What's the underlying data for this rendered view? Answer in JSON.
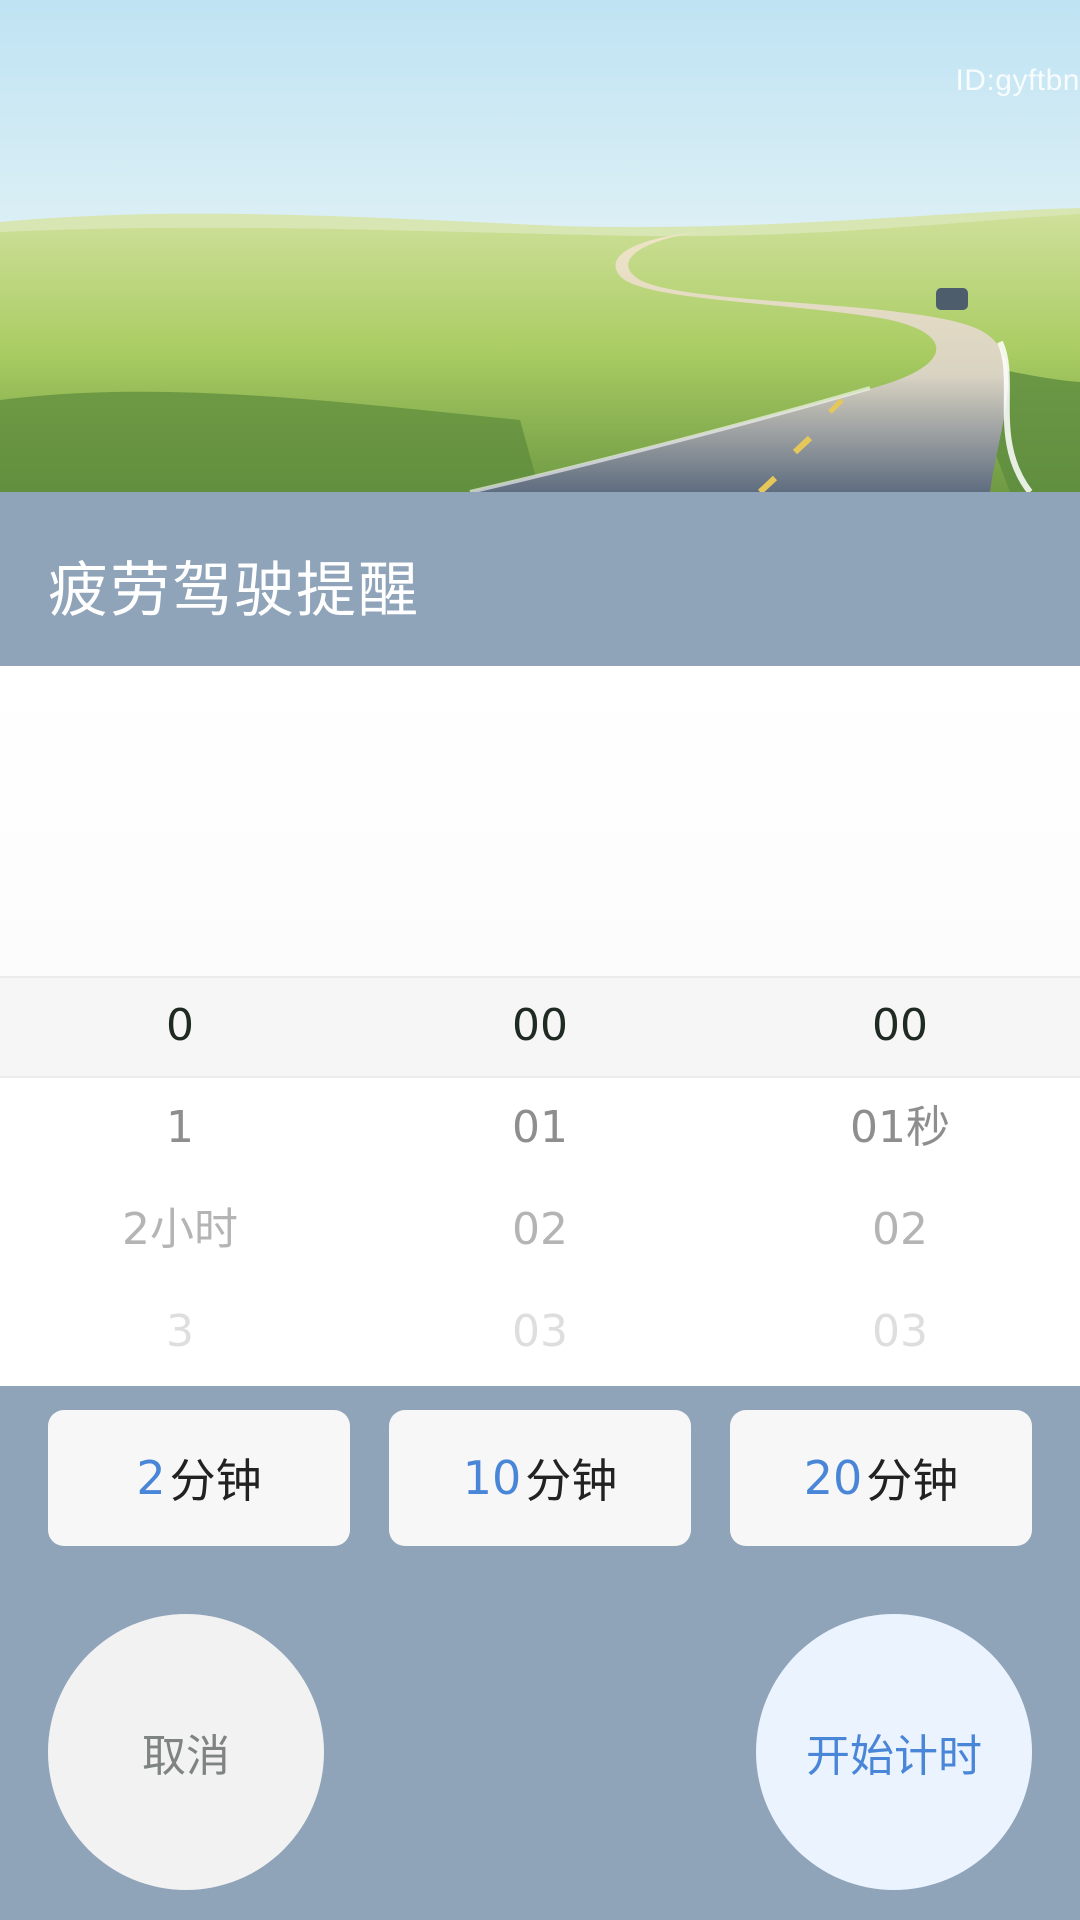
{
  "hero": {
    "watermark": "ID:gyftbn"
  },
  "header": {
    "title": "疲劳驾驶提醒"
  },
  "picker": {
    "hours": {
      "selected": "0",
      "next": [
        "1",
        "2小时",
        "3"
      ]
    },
    "minutes": {
      "selected": "00",
      "next": [
        "01",
        "02",
        "03"
      ]
    },
    "seconds": {
      "selected": "00",
      "next": [
        "01秒",
        "02",
        "03"
      ]
    }
  },
  "presets": [
    {
      "num": "2",
      "unit": "分钟"
    },
    {
      "num": "10",
      "unit": "分钟"
    },
    {
      "num": "20",
      "unit": "分钟"
    }
  ],
  "buttons": {
    "cancel": "取消",
    "start": "开始计时"
  },
  "colors": {
    "panel": "#8fa3b9",
    "accent": "#4a86d8",
    "chip_bg": "#f7f7f7",
    "cancel_bg": "#f1f2f1",
    "start_bg": "#eaf3fe"
  }
}
